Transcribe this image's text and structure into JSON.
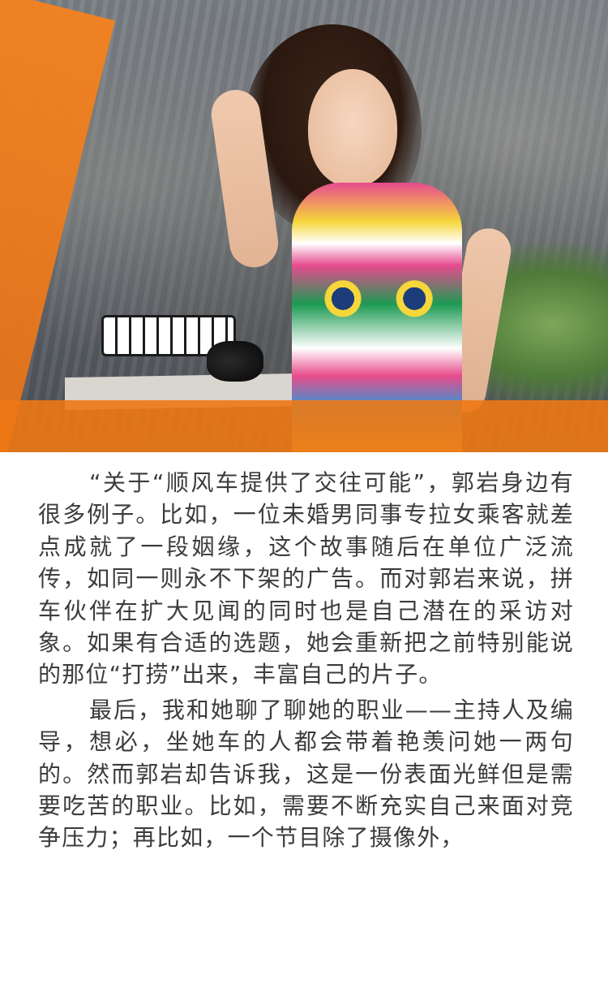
{
  "article": {
    "paragraph_1": "“关于“顺风车提供了交往可能”，郭岩身边有很多例子。比如，一位未婚男同事专拉女乘客就差点成就了一段姻缘，这个故事随后在单位广泛流传，如同一则永不下架的广告。而对郭岩来说，拼车伙伴在扩大见闻的同时也是自己潜在的采访对象。如果有合适的选题，她会重新把之前特别能说的那位“打捞”出来，丰富自己的片子。",
    "paragraph_2": "最后，我和她聊了聊她的职业——主持人及编导，想必，坐她车的人都会带着艳羡问她一两句的。然而郭岩却告诉我，这是一份表面光鲜但是需要吃苦的职业。比如，需要不断充实自己来面对竞争压力；再比如，一个节目除了摄像外，"
  },
  "colors": {
    "accent_orange": "#f07f1c",
    "text": "#3c3c3c",
    "background": "#ffffff"
  }
}
